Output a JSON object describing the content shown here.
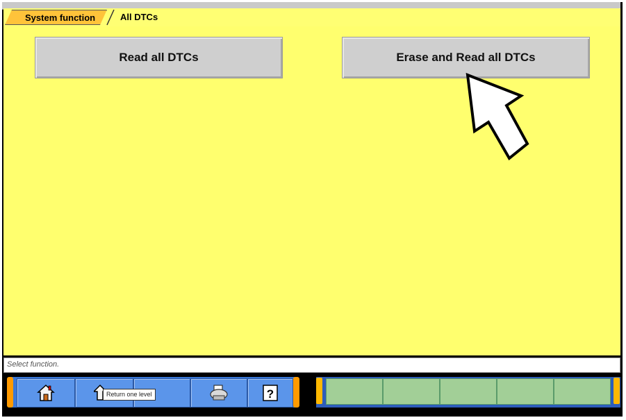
{
  "breadcrumb": {
    "parent": "System function",
    "current": "All DTCs"
  },
  "buttons": {
    "read_all": "Read all DTCs",
    "erase_and_read": "Erase and Read all DTCs"
  },
  "status": {
    "text": "Select function."
  },
  "toolbar": {
    "tooltip": "Return one level",
    "icons": [
      "home-icon",
      "up-level-icon",
      "printer-icon",
      "help-icon"
    ],
    "help_glyph": "?"
  },
  "colors": {
    "background": "#ffff6e",
    "breadcrumb_active": "#ffc33a",
    "button": "#cfcfcf",
    "toolbar_blue": "#3a78d8",
    "slot_green": "#a2cf97"
  }
}
